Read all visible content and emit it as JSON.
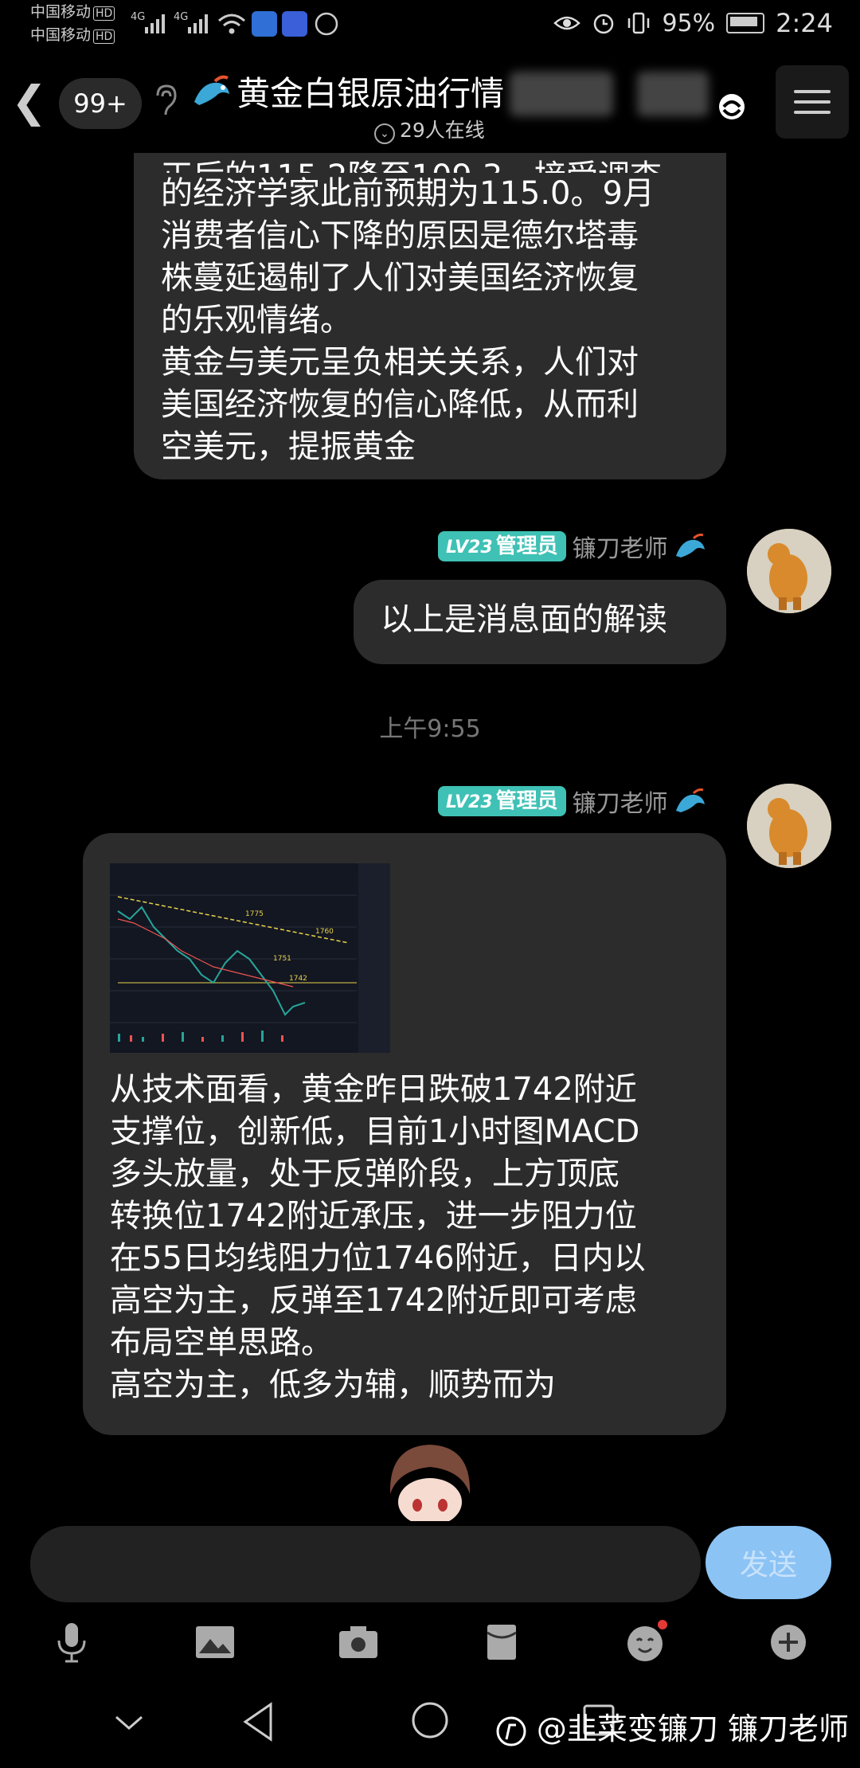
{
  "status_bar": {
    "carrier1": "中国移动",
    "carrier2": "中国移动",
    "hd": "HD",
    "net1": "4G",
    "net2": "4G",
    "battery": "95%",
    "time": "2:24"
  },
  "header": {
    "unread_badge": "99+",
    "title": "黄金白银原油行情",
    "online": "29人在线"
  },
  "messages": [
    {
      "lines": [
        "的经济学家此前预期为115.0。9月",
        "消费者信心下降的原因是德尔塔毒",
        "株蔓延遏制了人们对美国经济恢复",
        "的乐观情绪。",
        "黄金与美元呈负相关关系，人们对",
        "美国经济恢复的信心降低，从而利",
        "空美元，提振黄金"
      ]
    },
    {
      "level": "LV23",
      "role": "管理员",
      "sender": "镰刀老师",
      "text": "以上是消息面的解读"
    },
    {
      "level": "LV23",
      "role": "管理员",
      "sender": "镰刀老师",
      "chart_labels": [
        "1775",
        "1760",
        "1751",
        "1742"
      ],
      "lines": [
        "从技术面看，黄金昨日跌破1742附近",
        "支撑位，创新低，目前1小时图MACD",
        "多头放量，处于反弹阶段，上方顶底",
        "转换位1742附近承压，进一步阻力位",
        "在55日均线阻力位1746附近，日内以",
        "高空为主，反弹至1742附近即可考虑",
        "布局空单思路。",
        "高空为主，低多为辅，顺势而为"
      ]
    }
  ],
  "timestamp": "上午9:55",
  "input": {
    "send_label": "发送"
  },
  "watermark": "@韭菜变镰刀 镰刀老师",
  "colors": {
    "background": "#000000",
    "bubble": "#2c2c2c",
    "level_badge": "#3fc1b5",
    "send_button": "#8cc3f5",
    "notification_dot": "#e53935"
  }
}
